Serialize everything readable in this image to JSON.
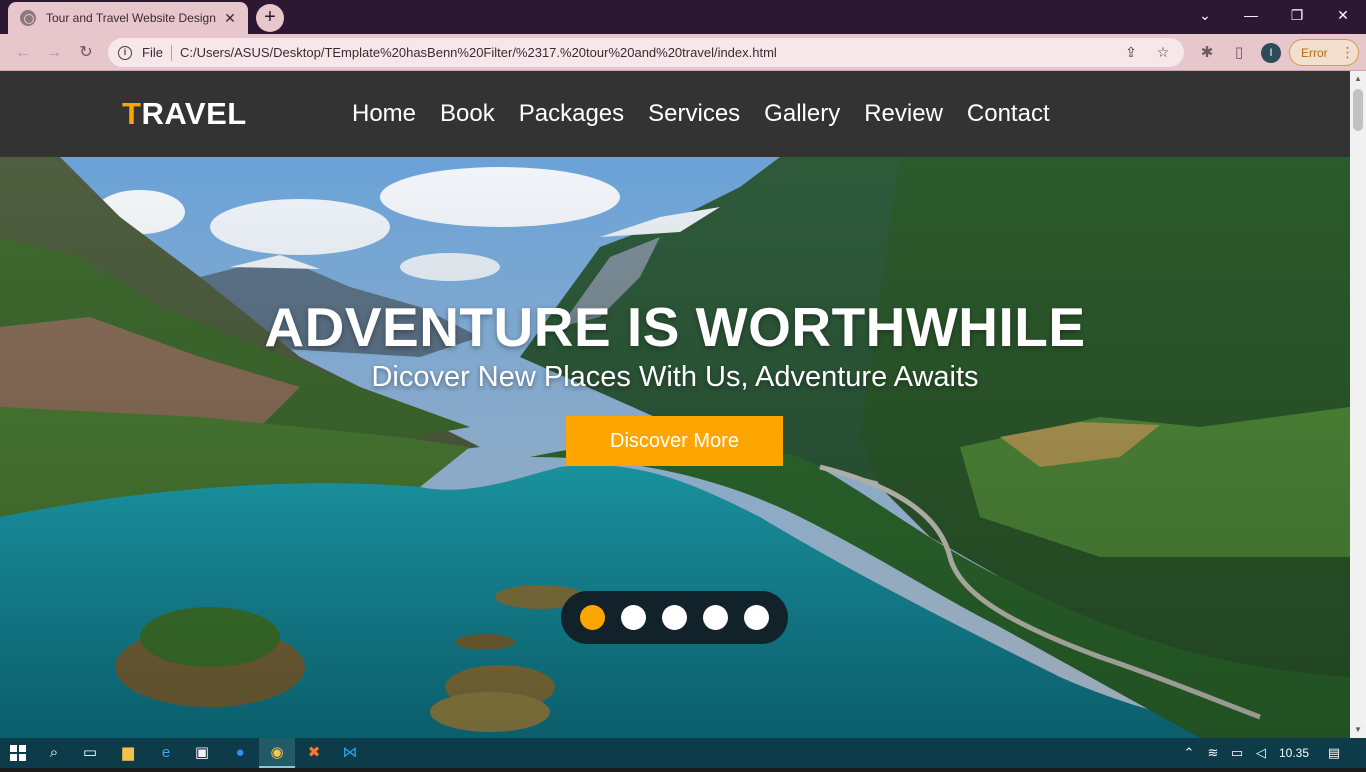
{
  "browser": {
    "tab_title": "Tour and Travel Website Design",
    "tab_close": "✕",
    "new_tab": "+",
    "window_minimize": "—",
    "window_restore": "❐",
    "window_close": "✕",
    "window_dropdown": "⌄",
    "back_icon": "←",
    "forward_icon": "→",
    "reload_icon": "↻",
    "url_scheme_label": "File",
    "url": "C:/Users/ASUS/Desktop/TEmplate%20hasBenn%20Filter/%2317.%20tour%20and%20travel/index.html",
    "profile_initial": "I",
    "error_label": "Error",
    "menu_dots": "⋮"
  },
  "site": {
    "logo_first": "T",
    "logo_rest": "RAVEL",
    "nav": [
      "Home",
      "Book",
      "Packages",
      "Services",
      "Gallery",
      "Review",
      "Contact"
    ],
    "hero": {
      "title": "ADVENTURE IS WORTHWHILE",
      "subtitle": "Dicover New Places With Us, Adventure Awaits",
      "button": "Discover More"
    },
    "slider": {
      "count": 5,
      "active_index": 0
    }
  },
  "colors": {
    "accent": "#ffa500",
    "header_bg": "#333333",
    "chrome_tab": "#e7c6cc",
    "titlebar": "#2d1833",
    "taskbar": "#0d3b49"
  },
  "taskbar": {
    "clock": "10.35",
    "icons": [
      "windows-start-icon",
      "search-icon",
      "task-view-icon",
      "file-explorer-icon",
      "edge-icon",
      "store-icon",
      "zoom-icon",
      "chrome-icon",
      "xampp-icon",
      "vscode-icon"
    ]
  }
}
